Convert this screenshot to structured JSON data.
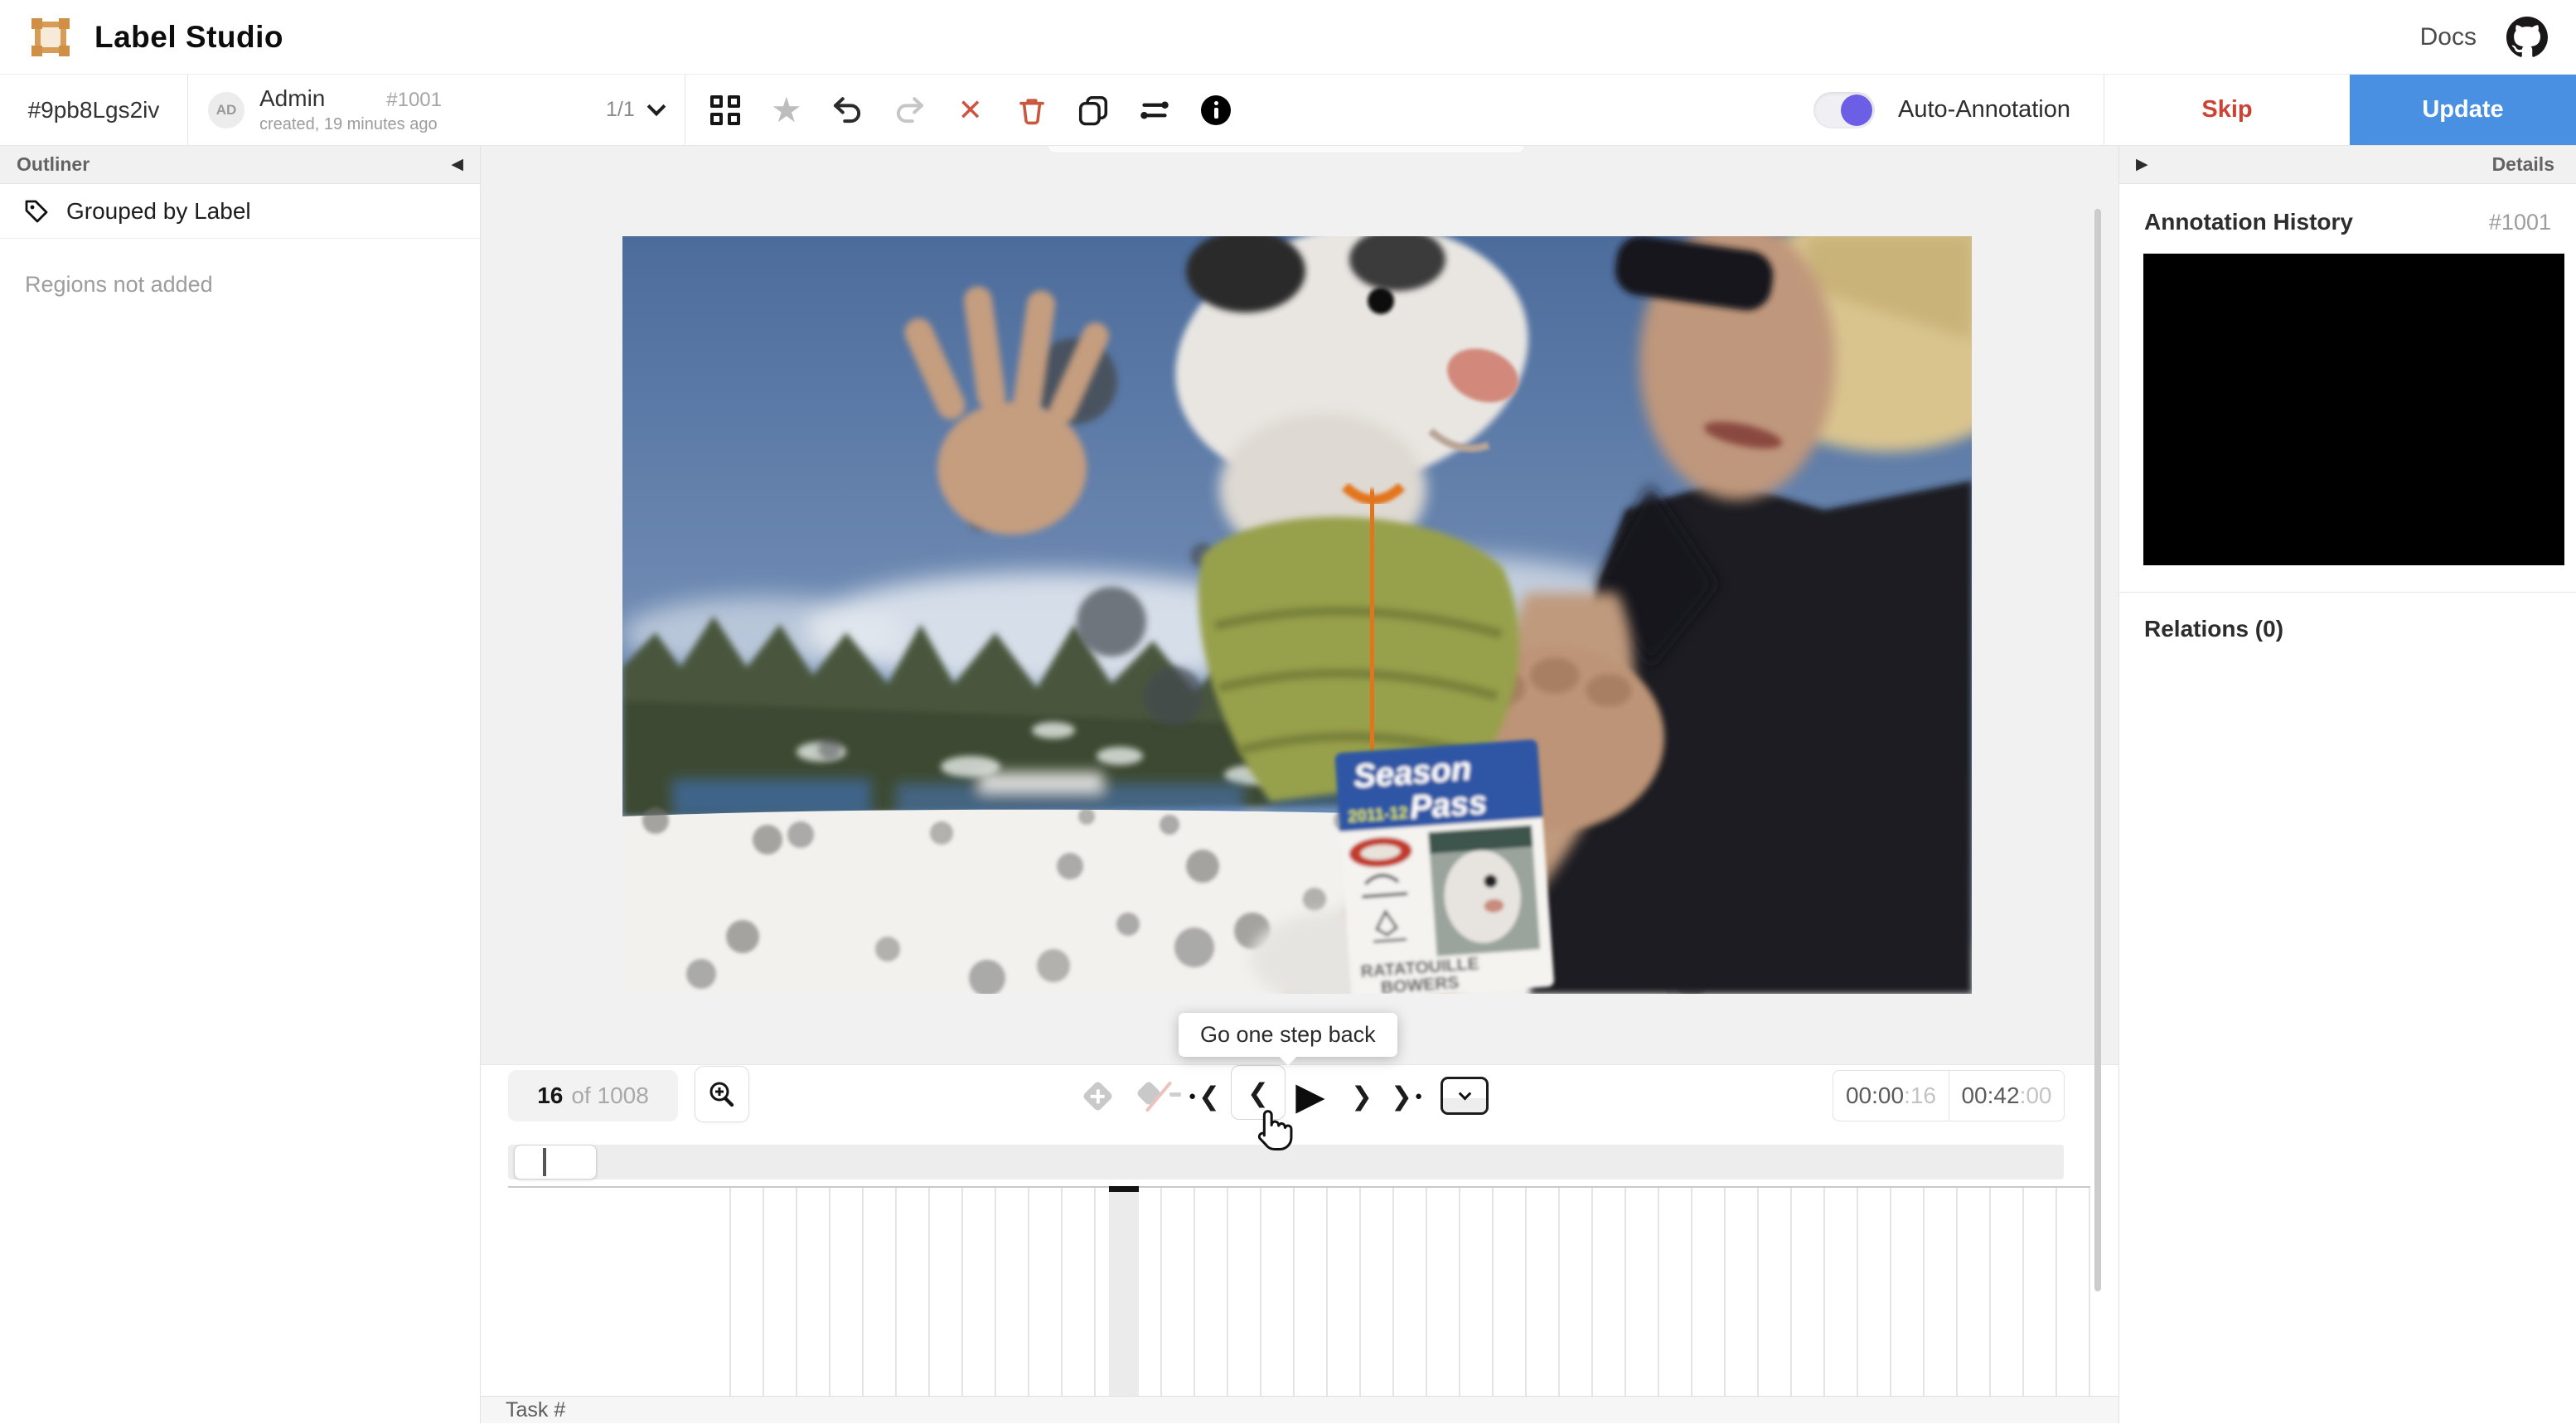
{
  "header": {
    "app_title": "Label Studio",
    "docs_label": "Docs"
  },
  "taskbar": {
    "task_id": "#9pb8Lgs2iv",
    "user_initials": "AD",
    "user_name": "Admin",
    "annotation_id": "#1001",
    "created_text": "created, 19 minutes ago",
    "annotation_counter": "1/1",
    "auto_annotation_label": "Auto-Annotation",
    "skip_label": "Skip",
    "update_label": "Update"
  },
  "outliner": {
    "title": "Outliner",
    "grouping": "Grouped by Label",
    "empty_message": "Regions not added"
  },
  "details": {
    "title": "Details",
    "annotation_history_title": "Annotation History",
    "annotation_id": "#1001",
    "relations_title": "Relations (0)"
  },
  "player": {
    "frame_current": "16",
    "frame_total": "of 1008",
    "tooltip": "Go one step back",
    "time_current_main": "00:00",
    "time_current_frames": ":16",
    "time_total_main": "00:42",
    "time_total_frames": ":00"
  },
  "timeline": {
    "task_row_label": "Task #"
  },
  "video_frame": {
    "badge_title_top": "Season",
    "badge_title_bottom": "Pass",
    "badge_year": "2011-12",
    "badge_name_line1": "RATATOUILLE",
    "badge_name_line2": "BOWERS"
  },
  "icons": {
    "triangle_left": "◀",
    "triangle_right": "▶",
    "star": "★",
    "close": "✕",
    "chevron_left": "❮",
    "chevron_right": "❯",
    "play": "▶",
    "dot": "●"
  },
  "colors": {
    "accent_blue": "#4a90e2",
    "skip_red": "#cb4335",
    "toggle_purple": "#6c5fe6",
    "danger_red": "#cf5340",
    "star_gray": "#bdbdbd"
  }
}
